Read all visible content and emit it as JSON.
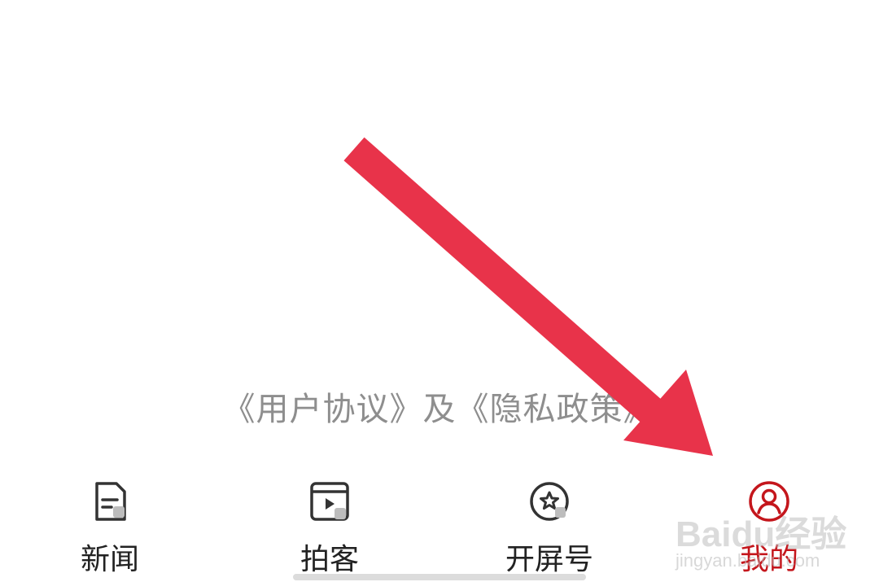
{
  "agreement": {
    "user_agreement": "《用户协议》",
    "connector": "及",
    "privacy_policy": "《隐私政策》"
  },
  "tabs": [
    {
      "label": "新闻",
      "icon": "news-document-icon",
      "active": false
    },
    {
      "label": "拍客",
      "icon": "video-play-icon",
      "active": false
    },
    {
      "label": "开屏号",
      "icon": "star-circle-icon",
      "active": false
    },
    {
      "label": "我的",
      "icon": "user-profile-icon",
      "active": true
    }
  ],
  "colors": {
    "active": "#c4161c",
    "inactive": "#222222",
    "secondary_text": "#8e8e8e",
    "annotation_arrow": "#e8334a"
  },
  "watermark": {
    "brand": "Baidu经验",
    "url": "jingyan.baidu.com"
  }
}
